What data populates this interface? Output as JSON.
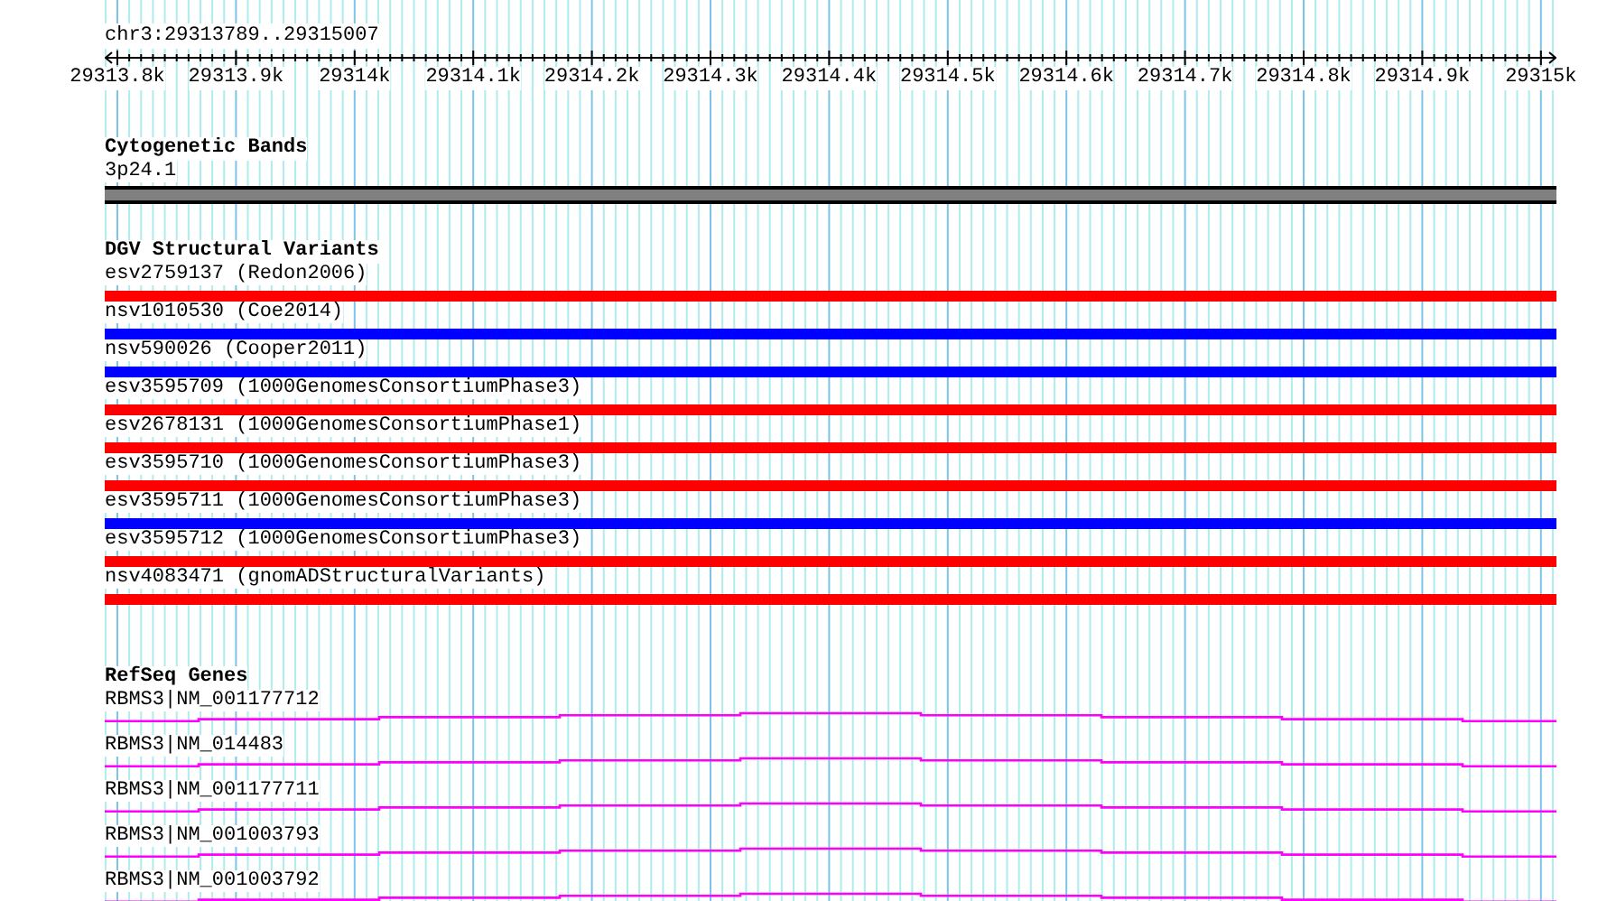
{
  "ruler": {
    "location": "chr3:29313789..29315007",
    "ticks": [
      "29313.8k",
      "29313.9k",
      "29314k",
      "29314.1k",
      "29314.2k",
      "29314.3k",
      "29314.4k",
      "29314.5k",
      "29314.6k",
      "29314.7k",
      "29314.8k",
      "29314.9k",
      "29315k"
    ]
  },
  "tracks": [
    {
      "kind": "bands",
      "title": "Cytogenetic Bands",
      "features": [
        {
          "label": "3p24.1",
          "color": "#808080"
        }
      ]
    },
    {
      "kind": "bars",
      "title": "DGV Structural Variants",
      "features": [
        {
          "label": "esv2759137 (Redon2006)",
          "color": "#ff0000"
        },
        {
          "label": "nsv1010530 (Coe2014)",
          "color": "#0000ff"
        },
        {
          "label": "nsv590026 (Cooper2011)",
          "color": "#0000ff"
        },
        {
          "label": "esv3595709 (1000GenomesConsortiumPhase3)",
          "color": "#ff0000"
        },
        {
          "label": "esv2678131 (1000GenomesConsortiumPhase1)",
          "color": "#ff0000"
        },
        {
          "label": "esv3595710 (1000GenomesConsortiumPhase3)",
          "color": "#ff0000"
        },
        {
          "label": "esv3595711 (1000GenomesConsortiumPhase3)",
          "color": "#0000ff"
        },
        {
          "label": "esv3595712 (1000GenomesConsortiumPhase3)",
          "color": "#ff0000"
        },
        {
          "label": "nsv4083471 (gnomADStructuralVariants)",
          "color": "#ff0000"
        }
      ]
    },
    {
      "kind": "genes",
      "title": "RefSeq Genes",
      "features": [
        {
          "label": "RBMS3|NM_001177712"
        },
        {
          "label": "RBMS3|NM_014483"
        },
        {
          "label": "RBMS3|NM_001177711"
        },
        {
          "label": "RBMS3|NM_001003793"
        },
        {
          "label": "RBMS3|NM_001003792"
        }
      ]
    }
  ]
}
